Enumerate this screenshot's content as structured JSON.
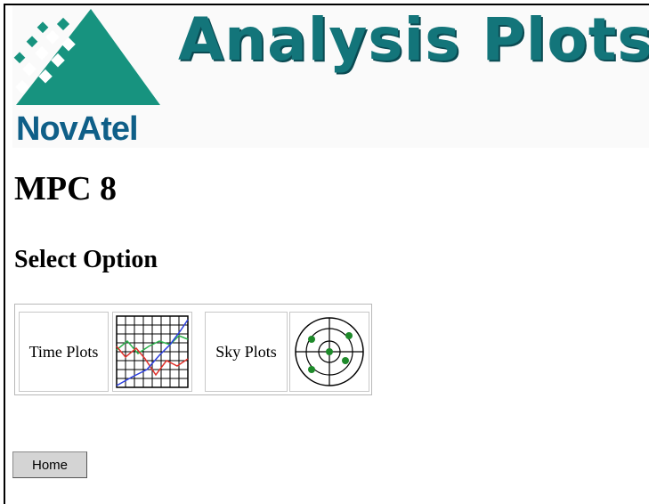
{
  "banner": {
    "brand_name": "NovAtel",
    "title": "Analysis Plots",
    "logo_icon": "novatel-triangle-logo"
  },
  "page": {
    "title": "MPC 8",
    "section_title": "Select Option"
  },
  "options": [
    {
      "label": "Time Plots",
      "icon": "time-plot-icon"
    },
    {
      "label": "Sky Plots",
      "icon": "sky-plot-icon"
    }
  ],
  "home_button": {
    "label": "Home"
  },
  "colors": {
    "brand_teal": "#13757a",
    "brand_blue": "#0f5f88",
    "logo_green": "#17937f"
  }
}
